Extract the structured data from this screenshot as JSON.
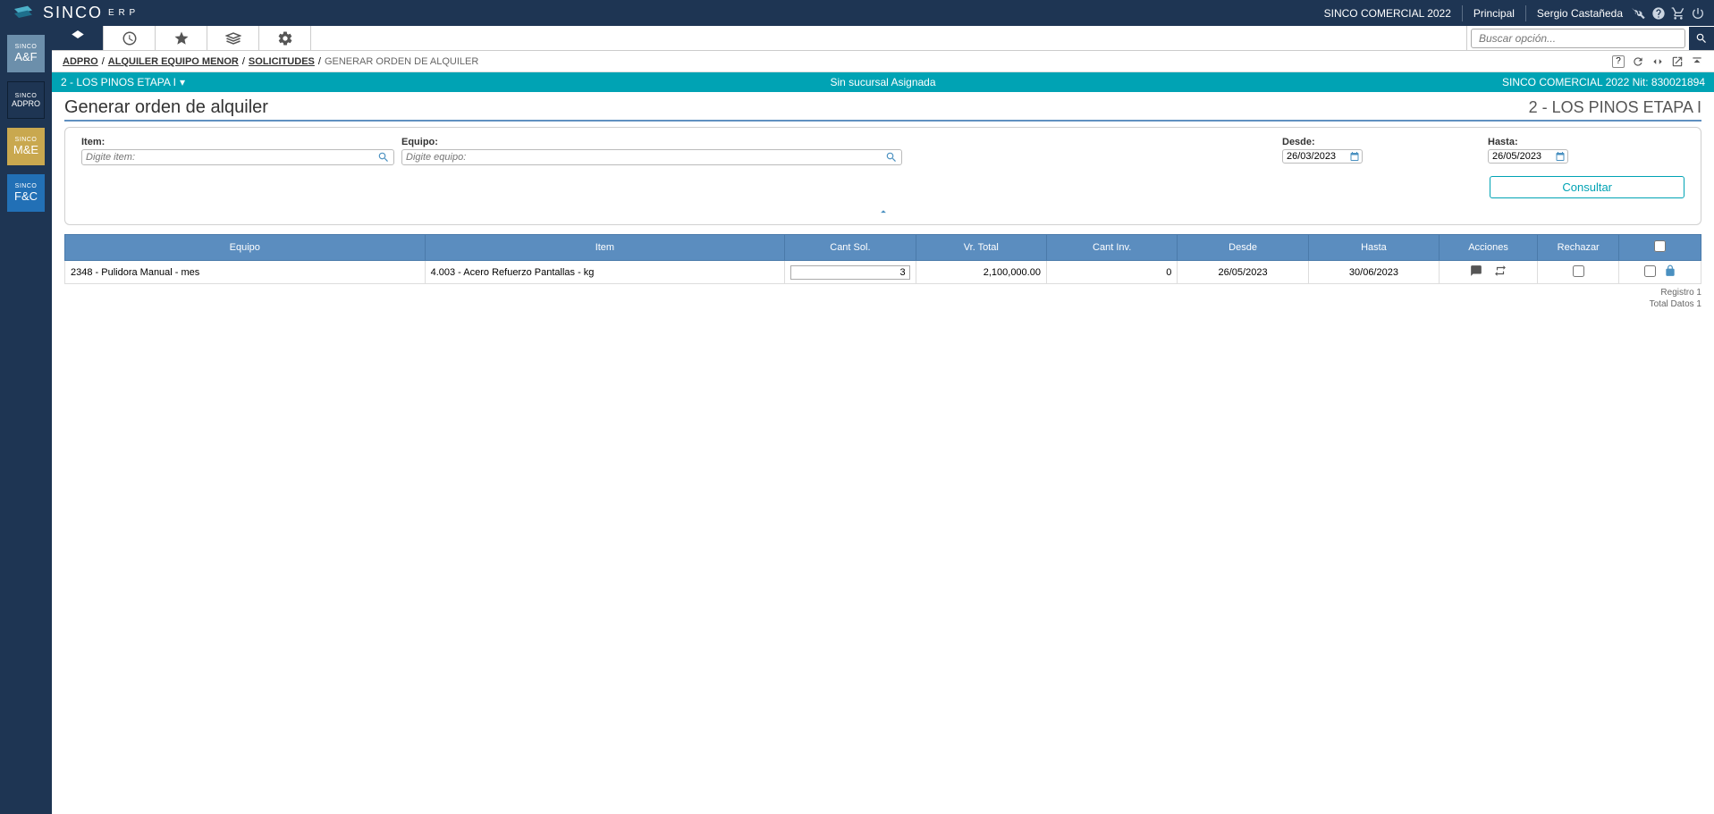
{
  "brand": {
    "name": "SINCO",
    "sub": "E R P"
  },
  "header": {
    "company": "SINCO COMERCIAL 2022",
    "role": "Principal",
    "user": "Sergio Castañeda"
  },
  "sidebar": {
    "items": [
      {
        "top": "SINCO",
        "bot": "A&F"
      },
      {
        "top": "SINCO",
        "bot": "ADPRO"
      },
      {
        "top": "SINCO",
        "bot": "M&E"
      },
      {
        "top": "SINCO",
        "bot": "F&C"
      }
    ]
  },
  "search": {
    "placeholder": "Buscar opción..."
  },
  "breadcrumb": {
    "a": "ADPRO",
    "b": "ALQUILER EQUIPO MENOR",
    "c": "SOLICITUDES",
    "d": "GENERAR ORDEN DE ALQUILER"
  },
  "projectbar": {
    "project": "2 - LOS PINOS ETAPA I",
    "center": "Sin sucursal Asignada",
    "right": "SINCO COMERCIAL 2022 Nit: 830021894"
  },
  "page": {
    "title": "Generar orden de alquiler",
    "right": "2 - LOS PINOS ETAPA I"
  },
  "filters": {
    "item_label": "Item:",
    "item_placeholder": "Digite item:",
    "equipo_label": "Equipo:",
    "equipo_placeholder": "Digite equipo:",
    "desde_label": "Desde:",
    "desde_value": "26/03/2023",
    "hasta_label": "Hasta:",
    "hasta_value": "26/05/2023",
    "consultar": "Consultar"
  },
  "grid": {
    "headers": {
      "equipo": "Equipo",
      "item": "Item",
      "cant_sol": "Cant Sol.",
      "vr_total": "Vr. Total",
      "cant_inv": "Cant Inv.",
      "desde": "Desde",
      "hasta": "Hasta",
      "acciones": "Acciones",
      "rechazar": "Rechazar"
    },
    "row": {
      "equipo": "2348 - Pulidora Manual - mes",
      "item": "4.003 - Acero Refuerzo Pantallas - kg",
      "cant_sol": "3",
      "vr_total": "2,100,000.00",
      "cant_inv": "0",
      "desde": "26/05/2023",
      "hasta": "30/06/2023"
    },
    "footer": {
      "reg": "Registro 1",
      "total": "Total Datos 1"
    }
  }
}
